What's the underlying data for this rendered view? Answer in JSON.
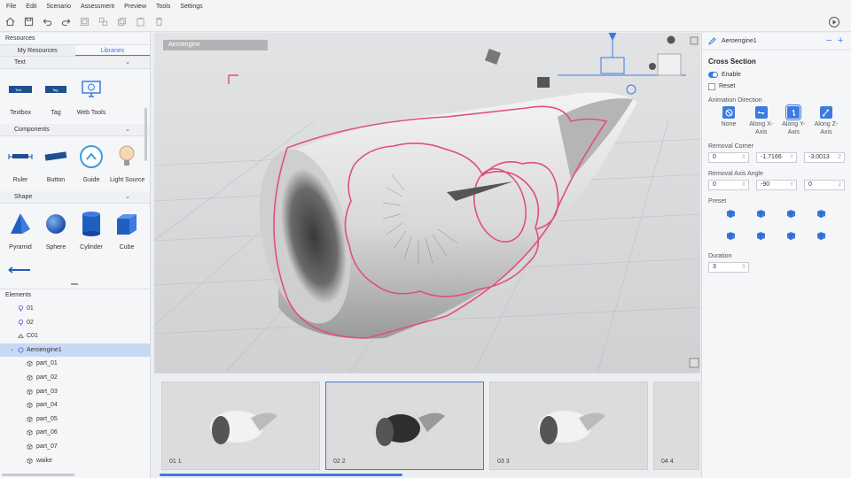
{
  "menu": [
    "File",
    "Edit",
    "Scenario",
    "Assessment",
    "Preview",
    "Tools",
    "Settings"
  ],
  "toolbar_icons": [
    "home-icon",
    "save-icon",
    "undo-icon",
    "redo-icon",
    "group-icon",
    "ungroup-icon",
    "copy-icon",
    "paste-icon",
    "delete-icon"
  ],
  "resources": {
    "title": "Resources",
    "tabs": [
      "My Resources",
      "Libraries"
    ],
    "sections": {
      "text": {
        "title": "Text",
        "items": [
          "Textbox",
          "Tag",
          "Web Tools"
        ],
        "thumb_text": [
          "Text",
          "Tag"
        ]
      },
      "components": {
        "title": "Components",
        "items": [
          "Ruler",
          "Button",
          "Guide",
          "Light Source"
        ]
      },
      "shape": {
        "title": "Shape",
        "items": [
          "Pyramid",
          "Sphere",
          "Cylinder",
          "Cube"
        ]
      }
    }
  },
  "elements": {
    "title": "Elements",
    "items": [
      "01",
      "02",
      "C01",
      "Aeroengine1",
      "part_01",
      "part_02",
      "part_03",
      "part_04",
      "part_05",
      "part_06",
      "part_07",
      "waike"
    ]
  },
  "viewport": {
    "label": "Aeroengine"
  },
  "filmstrip": [
    "01  1",
    "02  2",
    "03  3",
    "04  4"
  ],
  "properties": {
    "object_name": "Aeroengine1",
    "section_title": "Cross Section",
    "enable_label": "Enable",
    "reset_label": "Reset",
    "animation_direction_label": "Animation Direction",
    "directions": [
      "None",
      "Along X-Axis",
      "Along Y-Axis",
      "Along Z-Axis"
    ],
    "removal_corner_label": "Removal Corner",
    "removal_corner": [
      "0",
      "-1.7166",
      "-3.0013"
    ],
    "removal_axis_angle_label": "Removal Axis Angle",
    "removal_axis_angle": [
      "0",
      "-90",
      "0"
    ],
    "axes": [
      "X",
      "Y",
      "Z"
    ],
    "preset_label": "Preset",
    "duration_label": "Duration",
    "duration": "3",
    "duration_unit": "S"
  },
  "colors": {
    "accent": "#3d7be0",
    "section_outline": "#e0507a",
    "selected_row": "#c9d9f5"
  }
}
